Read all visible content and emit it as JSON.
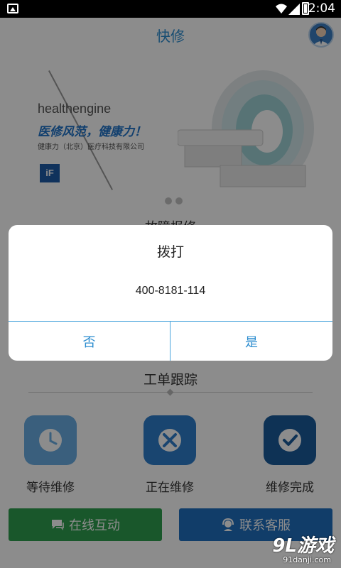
{
  "status_bar": {
    "time": "2:04"
  },
  "header": {
    "title": "快修"
  },
  "banner": {
    "brand": "healthengine",
    "slogan": "医修风范，健康力！",
    "company": "健康力（北京）医疗科技有限公司",
    "logo_text": "iF"
  },
  "partial_section_title": "故障报修",
  "work_order": {
    "title": "工单跟踪",
    "items": [
      {
        "label": "等待维修",
        "icon": "clock-icon",
        "color": "#6aaee3"
      },
      {
        "label": "正在维修",
        "icon": "tools-icon",
        "color": "#2f7fcc"
      },
      {
        "label": "维修完成",
        "icon": "check-icon",
        "color": "#1a5b9c"
      }
    ]
  },
  "buttons": {
    "online": "在线互动",
    "contact": "联系客服"
  },
  "dialog": {
    "title": "拨打",
    "number": "400-8181-114",
    "no": "否",
    "yes": "是"
  },
  "watermark": {
    "main": "9L游戏",
    "sub": "91danji.com"
  },
  "colors": {
    "accent": "#2b8ccf",
    "green": "#2e9e4f",
    "blue": "#1f70c0"
  }
}
